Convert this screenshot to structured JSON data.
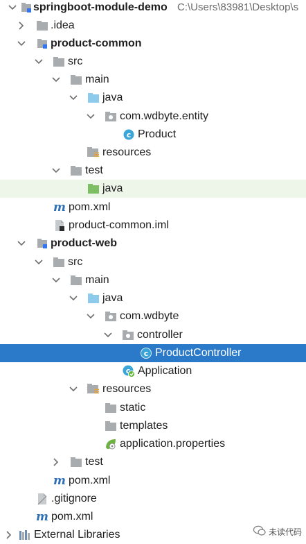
{
  "root": {
    "label": "springboot-module-demo",
    "path": "C:\\Users\\83981\\Desktop\\s"
  },
  "nodes": {
    "idea": ".idea",
    "product_common": "product-common",
    "src1": "src",
    "main1": "main",
    "java1": "java",
    "pkg_entity": "com.wdbyte.entity",
    "product_class": "Product",
    "resources1": "resources",
    "test1": "test",
    "test_java": "java",
    "pom1": "pom.xml",
    "iml": "product-common.iml",
    "product_web": "product-web",
    "src2": "src",
    "main2": "main",
    "java2": "java",
    "pkg_web": "com.wdbyte",
    "controller": "controller",
    "product_controller": "ProductController",
    "application": "Application",
    "resources2": "resources",
    "static": "static",
    "templates": "templates",
    "app_props": "application.properties",
    "test2": "test",
    "pom2": "pom.xml",
    "gitignore": ".gitignore",
    "pom_root": "pom.xml",
    "external_libs": "External Libraries"
  },
  "watermark": "未读代码",
  "colors": {
    "selection": "#2a7ac9",
    "highlight": "#eef6e9",
    "folder": "#a8acaf",
    "java_folder": "#8ccbec",
    "test_folder": "#7fbf63",
    "class_icon": "#3aa5d6",
    "module_blue": "#3574f0"
  },
  "icons": [
    "folder-icon",
    "module-icon",
    "java-source-folder-icon",
    "test-source-folder-icon",
    "package-icon",
    "class-icon",
    "spring-app-icon",
    "resources-folder-icon",
    "maven-icon",
    "iml-file-icon",
    "gitignore-icon",
    "spring-properties-icon",
    "library-icon"
  ]
}
